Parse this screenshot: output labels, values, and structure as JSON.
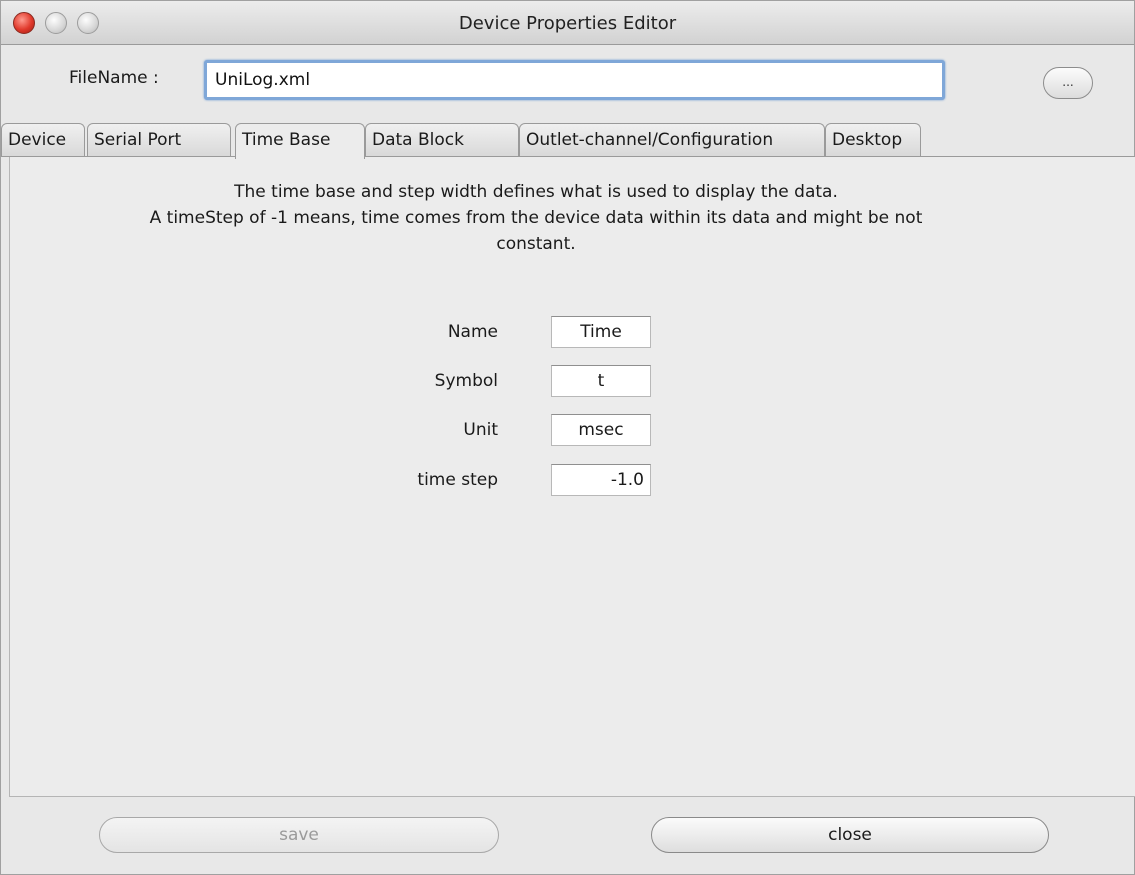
{
  "window": {
    "title": "Device Properties Editor"
  },
  "file": {
    "label": "FileName :",
    "value": "UniLog.xml",
    "browse_label": "..."
  },
  "tabs": [
    {
      "label": "Device"
    },
    {
      "label": "Serial Port"
    },
    {
      "label": "Time Base",
      "active": true
    },
    {
      "label": "Data Block"
    },
    {
      "label": "Outlet-channel/Configuration"
    },
    {
      "label": "Desktop"
    }
  ],
  "time_base": {
    "description": [
      "The time base and step width defines what is used to display the data.",
      "A timeStep of -1 means, time comes from the device data within its data and might be not",
      "constant."
    ],
    "fields": [
      {
        "label": "Name",
        "value": "Time"
      },
      {
        "label": "Symbol",
        "value": "t"
      },
      {
        "label": "Unit",
        "value": "msec"
      },
      {
        "label": "time step",
        "value": "-1.0"
      }
    ]
  },
  "buttons": {
    "save": "save",
    "close": "close"
  },
  "colors": {
    "focus_ring": "#7fa7d8",
    "close_light": "#e0392b",
    "disabled_text": "#9a9a9a"
  }
}
